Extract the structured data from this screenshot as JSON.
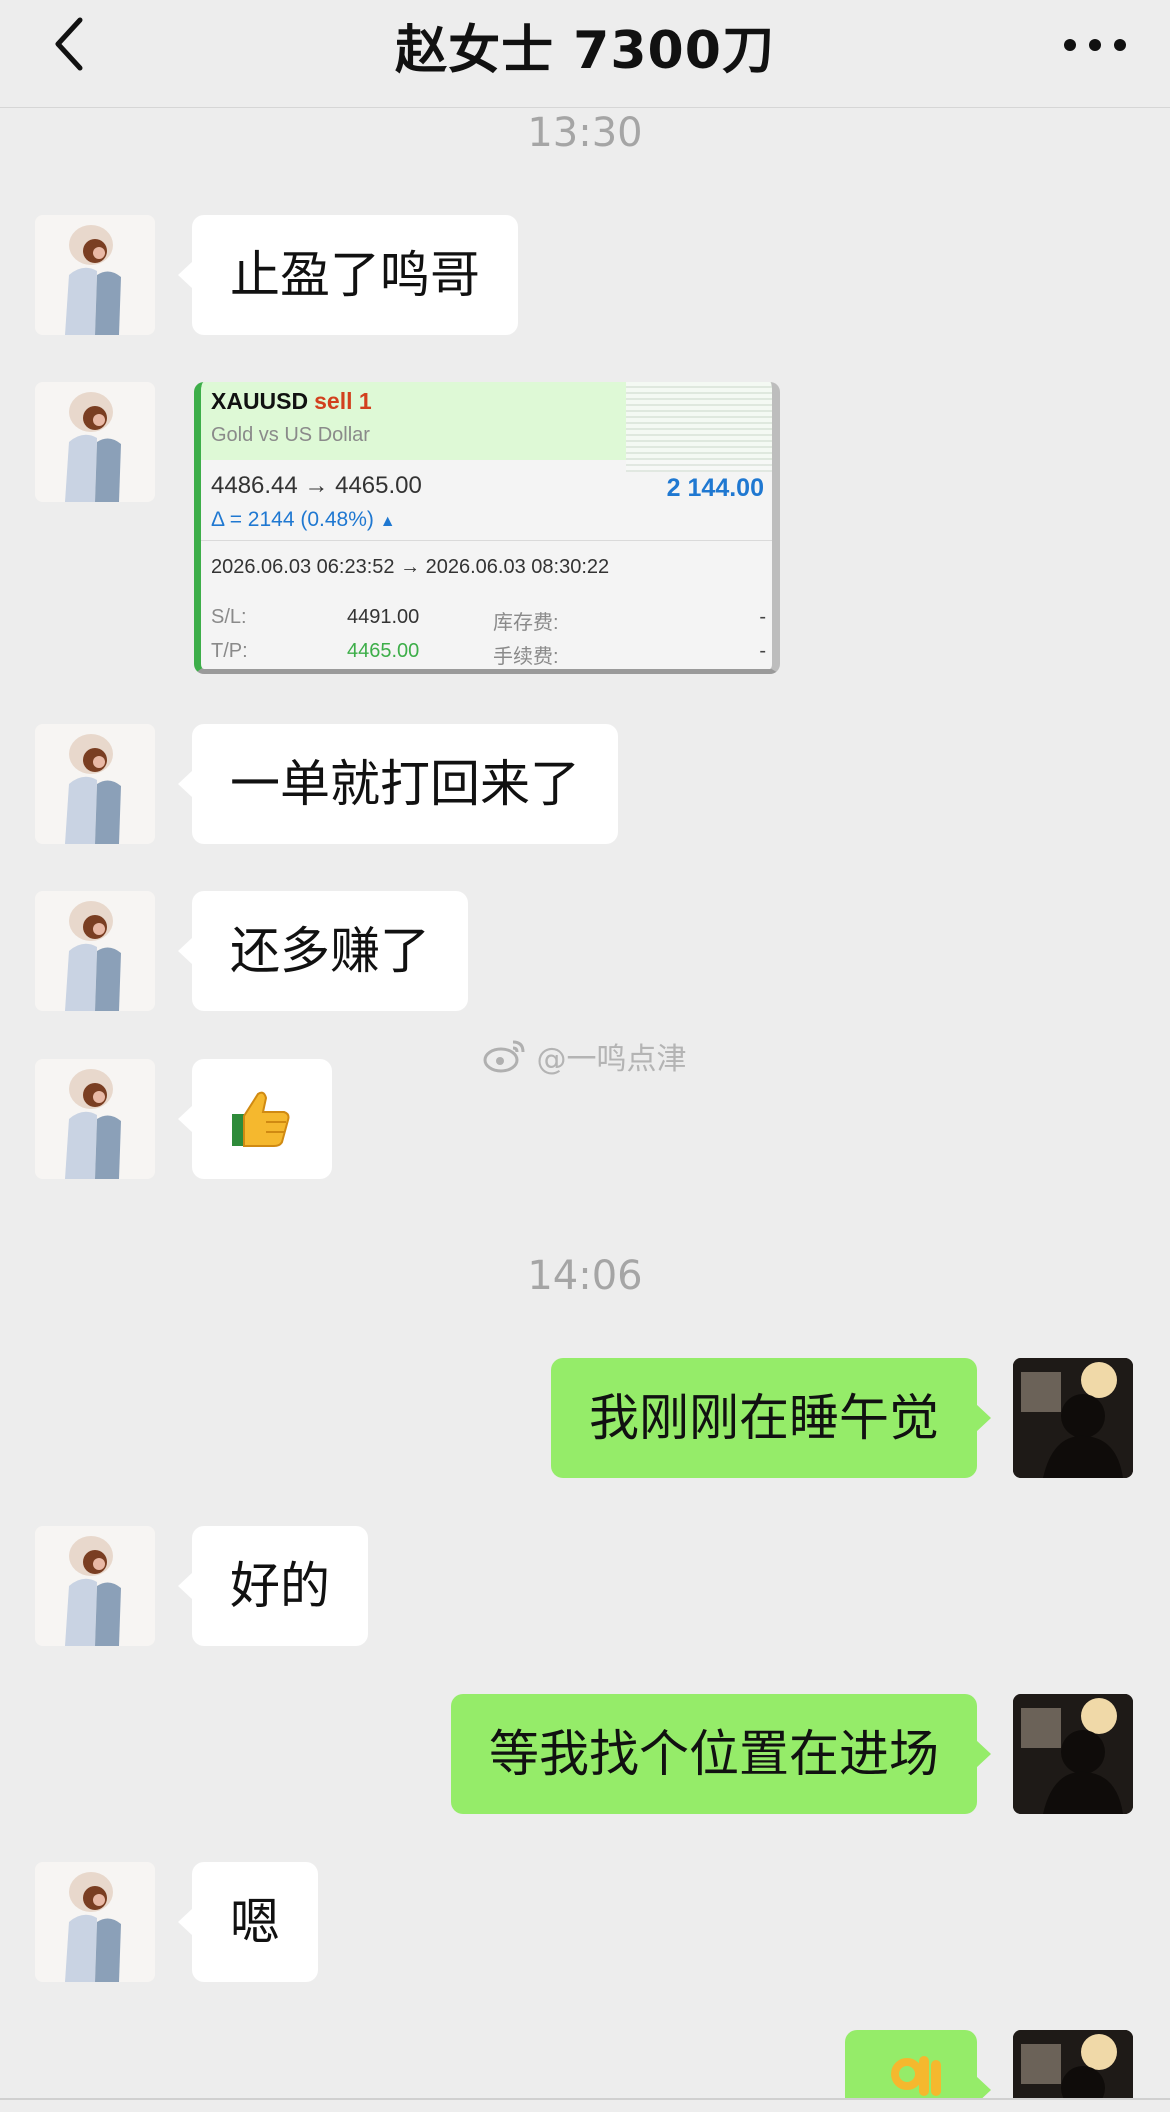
{
  "header": {
    "title": "赵女士  7300刀"
  },
  "timestamps": [
    "13:30",
    "14:06"
  ],
  "messages": [
    {
      "from": "contact",
      "text": "止盈了鸣哥"
    },
    {
      "from": "contact",
      "type": "image"
    },
    {
      "from": "contact",
      "text": "一单就打回来了"
    },
    {
      "from": "contact",
      "text": "还多赚了"
    },
    {
      "from": "contact",
      "type": "emoji",
      "emoji": "thumbs-up"
    },
    {
      "from": "me",
      "text": "我刚刚在睡午觉"
    },
    {
      "from": "contact",
      "text": "好的"
    },
    {
      "from": "me",
      "text": "等我找个位置在进场"
    },
    {
      "from": "contact",
      "text": "嗯"
    },
    {
      "from": "me",
      "type": "emoji",
      "emoji": "ok-hand"
    }
  ],
  "trade_card": {
    "symbol": "XAUUSD",
    "action": "sell 1",
    "description": "Gold vs US Dollar",
    "prices": "4486.44 → 4465.00",
    "profit": "2 144.00",
    "delta": "Δ = 2144 (0.48%)",
    "time_range": "2026.06.03 06:23:52 → 2026.06.03 08:30:22",
    "sl_label": "S/L:",
    "sl_value": "4491.00",
    "tp_label": "T/P:",
    "tp_value": "4465.00",
    "swap_label": "库存费:",
    "swap_value": "-",
    "commission_label": "手续费:",
    "commission_value": "-"
  },
  "watermark": "@一鸣点津",
  "colors": {
    "background": "#ededed",
    "bubble_incoming": "#ffffff",
    "bubble_outgoing": "#95ec69",
    "profit_blue": "#1f78d1",
    "sell_red": "#d2401e",
    "tp_green": "#3dae49"
  }
}
